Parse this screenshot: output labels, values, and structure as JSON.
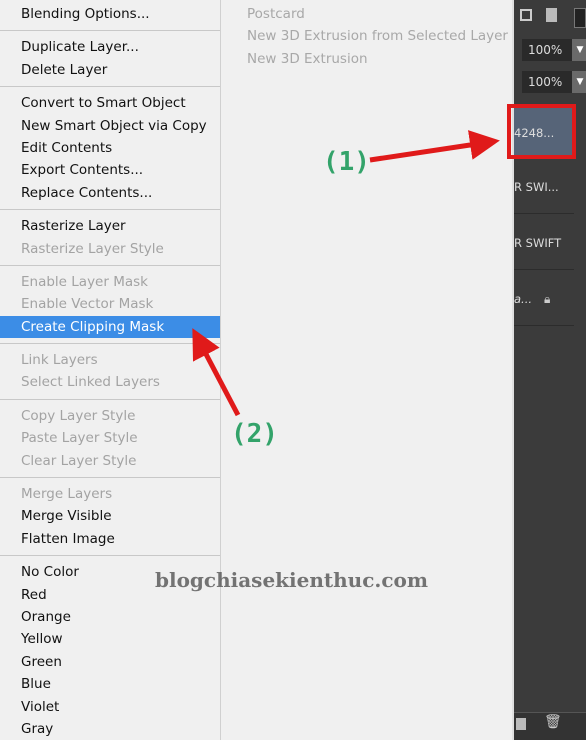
{
  "menu": {
    "groups": [
      [
        {
          "label": "Blending Options...",
          "enabled": true
        }
      ],
      [
        {
          "label": "Duplicate Layer...",
          "enabled": true
        },
        {
          "label": "Delete Layer",
          "enabled": true
        }
      ],
      [
        {
          "label": "Convert to Smart Object",
          "enabled": true
        },
        {
          "label": "New Smart Object via Copy",
          "enabled": true
        },
        {
          "label": "Edit Contents",
          "enabled": true
        },
        {
          "label": "Export Contents...",
          "enabled": true
        },
        {
          "label": "Replace Contents...",
          "enabled": true
        }
      ],
      [
        {
          "label": "Rasterize Layer",
          "enabled": true
        },
        {
          "label": "Rasterize Layer Style",
          "enabled": false
        }
      ],
      [
        {
          "label": "Enable Layer Mask",
          "enabled": false
        },
        {
          "label": "Enable Vector Mask",
          "enabled": false
        },
        {
          "label": "Create Clipping Mask",
          "enabled": true,
          "highlighted": true
        }
      ],
      [
        {
          "label": "Link Layers",
          "enabled": false
        },
        {
          "label": "Select Linked Layers",
          "enabled": false
        }
      ],
      [
        {
          "label": "Copy Layer Style",
          "enabled": false
        },
        {
          "label": "Paste Layer Style",
          "enabled": false
        },
        {
          "label": "Clear Layer Style",
          "enabled": false
        }
      ],
      [
        {
          "label": "Merge Layers",
          "enabled": false
        },
        {
          "label": "Merge Visible",
          "enabled": true
        },
        {
          "label": "Flatten Image",
          "enabled": true
        }
      ],
      [
        {
          "label": "No Color",
          "enabled": true
        },
        {
          "label": "Red",
          "enabled": true
        },
        {
          "label": "Orange",
          "enabled": true
        },
        {
          "label": "Yellow",
          "enabled": true
        },
        {
          "label": "Green",
          "enabled": true
        },
        {
          "label": "Blue",
          "enabled": true
        },
        {
          "label": "Violet",
          "enabled": true
        },
        {
          "label": "Gray",
          "enabled": true
        }
      ]
    ]
  },
  "submenu": [
    "Postcard",
    "New 3D Extrusion from Selected Layer",
    "New 3D Extrusion"
  ],
  "panel": {
    "opacity": "100%",
    "fill": "100%",
    "layers": [
      "4248...",
      "R SWI...",
      "R SWIFT",
      "a..."
    ]
  },
  "annotations": {
    "one": "(1)",
    "two": "(2)",
    "watermark": "blogchiasekienthuc.com"
  },
  "colors": {
    "highlight": "#3c8de6",
    "arrow": "#e01a1a",
    "label": "#33a36a"
  }
}
